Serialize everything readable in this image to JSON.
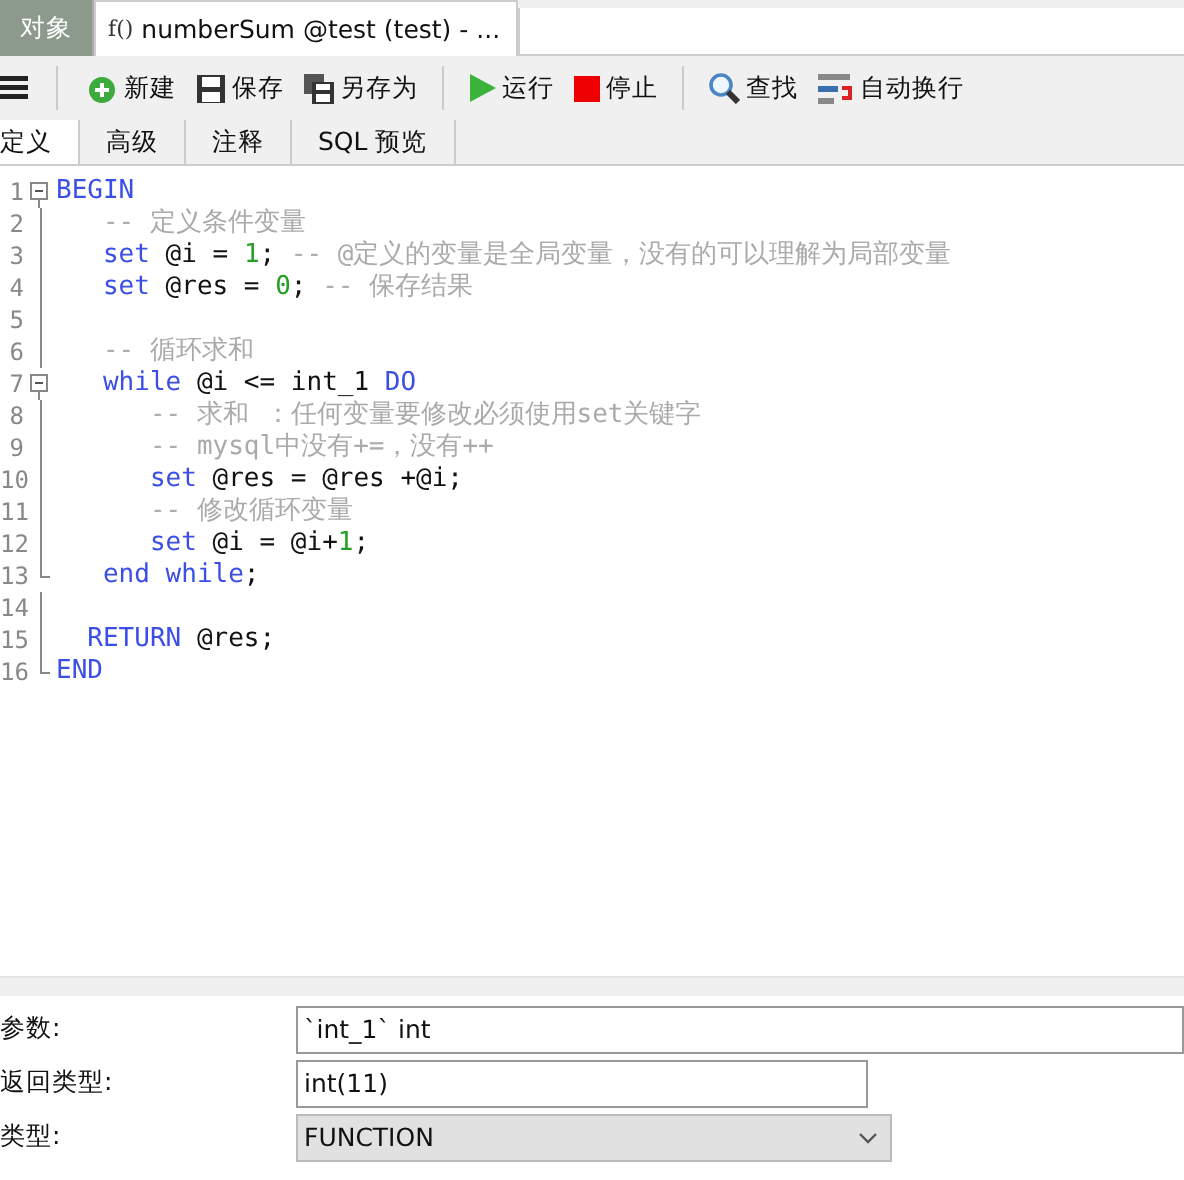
{
  "tabs": [
    {
      "label": "对象",
      "selected": false,
      "kind": "plain"
    },
    {
      "label": "numberSum @test (test) - ...",
      "icon_text": "f()",
      "selected": true,
      "kind": "function"
    }
  ],
  "toolbar": [
    {
      "kind": "menu"
    },
    {
      "kind": "new",
      "label": "新建"
    },
    {
      "kind": "save",
      "label": "保存"
    },
    {
      "kind": "saveas",
      "label": "另存为"
    },
    {
      "kind": "run",
      "label": "运行"
    },
    {
      "kind": "stop",
      "label": "停止"
    },
    {
      "kind": "find",
      "label": "查找"
    },
    {
      "kind": "wrap",
      "label": "自动换行"
    }
  ],
  "subtabs": [
    {
      "label": "定义",
      "selected": true
    },
    {
      "label": "高级",
      "selected": false
    },
    {
      "label": "注释",
      "selected": false
    },
    {
      "label": "SQL 预览",
      "selected": false
    }
  ],
  "code": [
    {
      "number": "1",
      "kind": "fold-start",
      "tokens": [
        {
          "kind": "keyword",
          "text": "BEGIN"
        }
      ]
    },
    {
      "number": "2",
      "kind": "body",
      "tokens": [
        {
          "kind": "comment",
          "text": "   -- 定义条件变量"
        }
      ]
    },
    {
      "number": "3",
      "kind": "body",
      "tokens": [
        {
          "kind": "keyword",
          "text": "   set"
        },
        {
          "kind": "plain",
          "text": " @i = "
        },
        {
          "kind": "number",
          "text": "1"
        },
        {
          "kind": "plain",
          "text": "; "
        },
        {
          "kind": "comment",
          "text": "-- @定义的变量是全局变量，没有的可以理解为局部变量"
        }
      ]
    },
    {
      "number": "4",
      "kind": "body",
      "tokens": [
        {
          "kind": "keyword",
          "text": "   set"
        },
        {
          "kind": "plain",
          "text": " @res = "
        },
        {
          "kind": "number",
          "text": "0"
        },
        {
          "kind": "plain",
          "text": "; "
        },
        {
          "kind": "comment",
          "text": "-- 保存结果"
        }
      ]
    },
    {
      "number": "5",
      "kind": "body"
    },
    {
      "number": "6",
      "kind": "body",
      "tokens": [
        {
          "kind": "comment",
          "text": "   -- 循环求和"
        }
      ]
    },
    {
      "number": "7",
      "kind": "fold-start",
      "tokens": [
        {
          "kind": "keyword",
          "text": "   while"
        },
        {
          "kind": "plain",
          "text": " @i <= int_1 "
        },
        {
          "kind": "keyword",
          "text": "DO"
        }
      ]
    },
    {
      "number": "8",
      "kind": "body",
      "tokens": [
        {
          "kind": "comment",
          "text": "      -- 求和 ：任何变量要修改必须使用set关键字"
        }
      ]
    },
    {
      "number": "9",
      "kind": "body",
      "tokens": [
        {
          "kind": "comment",
          "text": "      -- mysql中没有+=，没有++"
        }
      ]
    },
    {
      "number": "10",
      "kind": "body",
      "tokens": [
        {
          "kind": "keyword",
          "text": "      set"
        },
        {
          "kind": "plain",
          "text": " @res = @res +@i;"
        }
      ]
    },
    {
      "number": "11",
      "kind": "body",
      "tokens": [
        {
          "kind": "comment",
          "text": "      -- 修改循环变量"
        }
      ]
    },
    {
      "number": "12",
      "kind": "body",
      "tokens": [
        {
          "kind": "keyword",
          "text": "      set"
        },
        {
          "kind": "plain",
          "text": " @i = @i+"
        },
        {
          "kind": "number",
          "text": "1"
        },
        {
          "kind": "plain",
          "text": ";"
        }
      ]
    },
    {
      "number": "13",
      "kind": "fold-end",
      "tokens": [
        {
          "kind": "keyword",
          "text": "   end while"
        },
        {
          "kind": "plain",
          "text": ";"
        }
      ]
    },
    {
      "number": "14",
      "kind": "body"
    },
    {
      "number": "15",
      "kind": "body",
      "tokens": [
        {
          "kind": "keyword",
          "text": "  RETURN"
        },
        {
          "kind": "plain",
          "text": " @res;"
        }
      ]
    },
    {
      "number": "16",
      "kind": "fold-end",
      "tokens": [
        {
          "kind": "keyword",
          "text": "END"
        }
      ]
    }
  ],
  "fields": [
    {
      "label": "参数:",
      "kind": "text",
      "value": "`int_1` int"
    },
    {
      "label": "返回类型:",
      "kind": "short",
      "value": "int(11)"
    },
    {
      "label": "类型:",
      "kind": "select",
      "value": "FUNCTION"
    }
  ]
}
